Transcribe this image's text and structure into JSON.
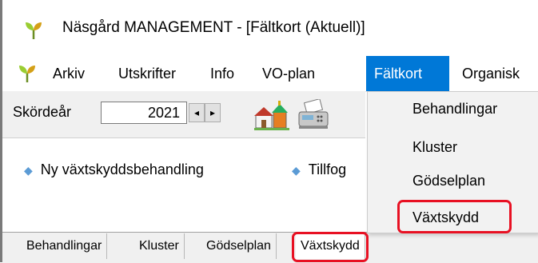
{
  "window": {
    "title": "Näsgård MANAGEMENT - [Fältkort (Aktuell)]",
    "icon": "plant-sprout-icon"
  },
  "menubar": {
    "items": [
      {
        "label": "Arkiv"
      },
      {
        "label": "Utskrifter"
      },
      {
        "label": "Info"
      },
      {
        "label": "VO-plan"
      },
      {
        "label": "Fältkort",
        "active": true
      },
      {
        "label": "Organisk"
      }
    ]
  },
  "toolbar": {
    "year_label": "Skördeår",
    "year_value": "2021",
    "spin_left": "◂",
    "spin_right": "▸",
    "icons": [
      "farm-buildings-icon",
      "fax-machine-icon"
    ]
  },
  "panel": {
    "links": [
      {
        "label": "Ny växtskyddsbehandling"
      },
      {
        "label": "Tillfog"
      }
    ]
  },
  "tabs": [
    {
      "label": "Behandlingar"
    },
    {
      "label": "Kluster"
    },
    {
      "label": "Gödselplan"
    },
    {
      "label": "Växtskydd",
      "selected": true
    }
  ],
  "dropdown": {
    "items": [
      {
        "label": "Behandlingar"
      },
      {
        "label": "Kluster"
      },
      {
        "label": "Gödselplan"
      },
      {
        "label": "Växtskydd",
        "highlighted": true
      }
    ]
  },
  "colors": {
    "menu_active": "#0078d7",
    "highlight_outline": "#e81123",
    "bullet": "#5b9bd5"
  }
}
